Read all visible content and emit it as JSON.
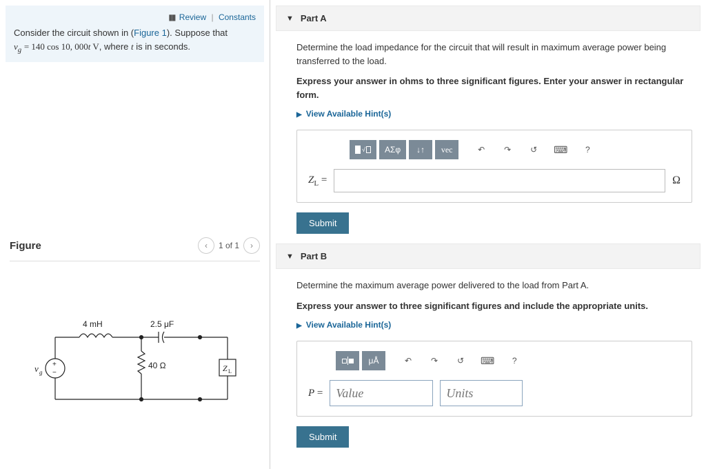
{
  "intro": {
    "review": "Review",
    "constants": "Constants",
    "line1_a": "Consider the circuit shown in (",
    "figure_link": "Figure 1",
    "line1_b": "). Suppose that",
    "line2_a": "v",
    "line2_sub": "g",
    "line2_eq": " = 140 cos 10, 000",
    "line2_t": "t",
    "line2_v": " V",
    "line2_b": ", where ",
    "line2_t2": "t",
    "line2_c": " is in seconds."
  },
  "figure": {
    "heading": "Figure",
    "pager": "1 of 1",
    "labels": {
      "vg": "v",
      "vg_sub": "g",
      "l": "4 mH",
      "c": "2.5 μF",
      "r": "40 Ω",
      "zl": "Z",
      "zl_sub": "L"
    }
  },
  "partA": {
    "header": "Part A",
    "q": "Determine the load impedance for the circuit that will result in maximum average power being transferred to the load.",
    "instr": "Express your answer in ohms to three significant figures. Enter your answer in rectangular form.",
    "hints": "View Available Hint(s)",
    "lhs_Z": "Z",
    "lhs_sub": "L",
    "lhs_eq": " =",
    "unit": "Ω",
    "toolbar": {
      "greek": "ΑΣφ",
      "vec": "vec",
      "help": "?"
    },
    "submit": "Submit"
  },
  "partB": {
    "header": "Part B",
    "q": "Determine the maximum average power delivered to the load from Part A.",
    "instr": "Express your answer to three significant figures and include the appropriate units.",
    "hints": "View Available Hint(s)",
    "lhs_P": "P",
    "lhs_eq": " =",
    "val_ph": "Value",
    "unit_ph": "Units",
    "toolbar": {
      "units": "μÅ",
      "help": "?"
    },
    "submit": "Submit"
  }
}
